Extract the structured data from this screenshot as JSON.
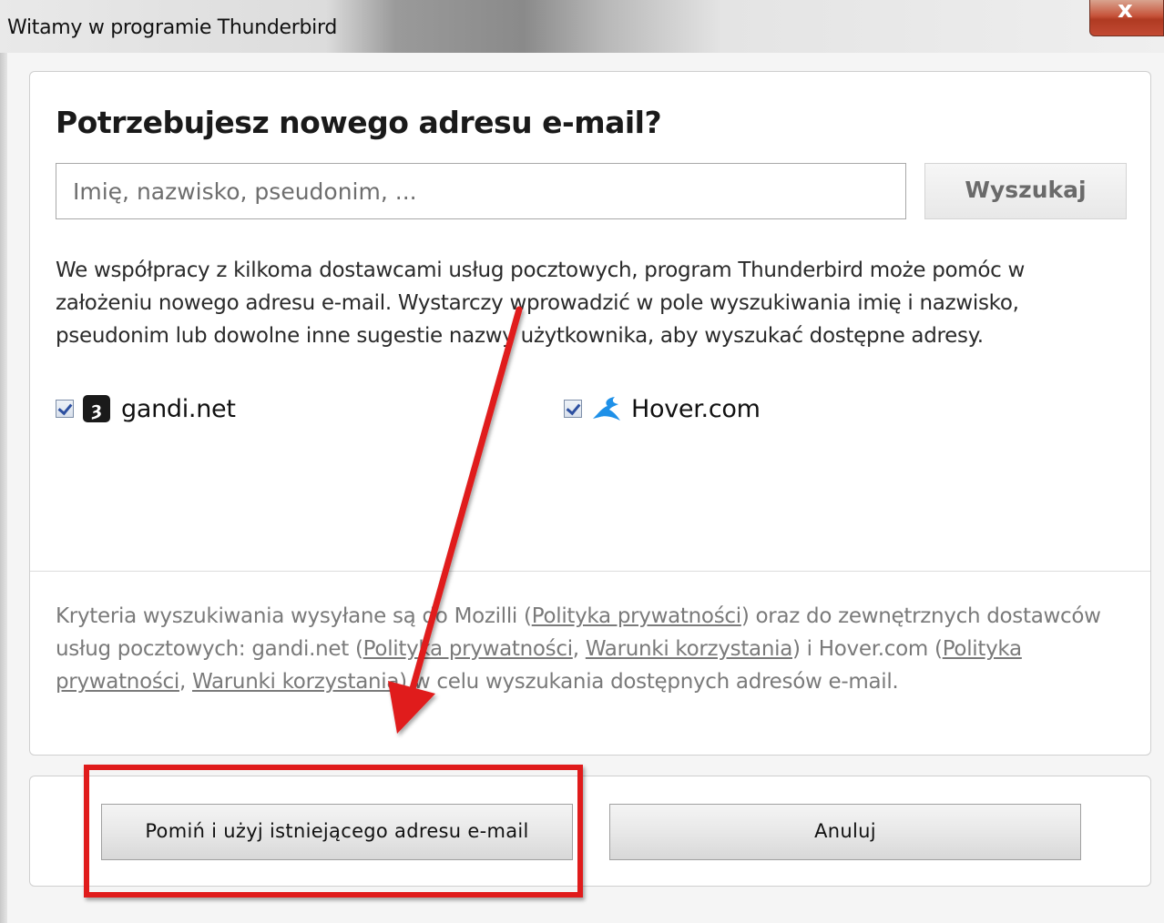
{
  "window": {
    "title": "Witamy w programie Thunderbird",
    "close_label": "x"
  },
  "heading": "Potrzebujesz nowego adresu e-mail?",
  "search": {
    "placeholder": "Imię, nazwisko, pseudonim, ...",
    "value": "",
    "button_label": "Wyszukaj"
  },
  "description": "We współpracy z kilkoma dostawcami usług pocztowych, program Thunderbird może pomóc w założeniu nowego adresu e-mail. Wystarczy wprowadzić w pole wyszukiwania imię i nazwisko, pseudonim lub dowolne inne sugestie nazwy użytkownika, aby wyszukać dostępne adresy.",
  "providers": [
    {
      "name": "gandi.net",
      "checked": true,
      "icon": "gandi-logo-icon",
      "icon_glyph": "ȝ"
    },
    {
      "name": "Hover.com",
      "checked": true,
      "icon": "hover-logo-icon"
    }
  ],
  "privacy": {
    "t1": "Kryteria wyszukiwania wysyłane są do Mozilli (",
    "l1": "Polityka prywatności",
    "t2": ") oraz do zewnętrznych dostawców usług pocztowych: gandi.net (",
    "l2": "Polityka prywatności",
    "t3": ", ",
    "l3": "Warunki korzystania",
    "t4": ") i Hover.com (",
    "l4": "Polityka prywatności",
    "t5": ", ",
    "l5": "Warunki korzystania",
    "t6": ") w celu wyszukania dostępnych adresów e-mail."
  },
  "buttons": {
    "skip_label": "Pomiń i użyj istniejącego adresu e-mail",
    "cancel_label": "Anuluj"
  },
  "colors": {
    "annotation": "#e01b1b",
    "hover_brand": "#1e90e8"
  }
}
